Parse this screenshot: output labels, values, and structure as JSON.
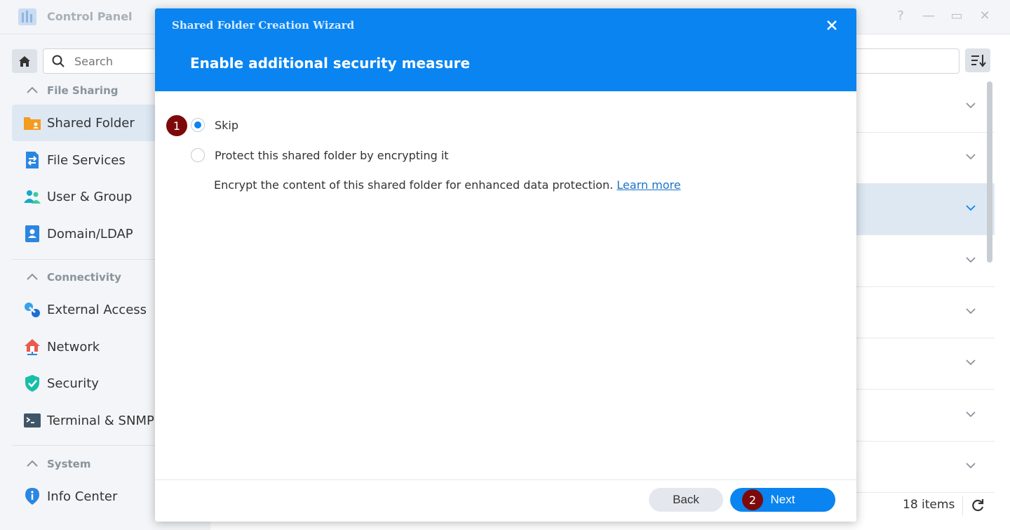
{
  "window": {
    "title": "Control Panel",
    "controls": [
      "?",
      "—",
      "▭",
      "✕"
    ]
  },
  "sidebar": {
    "search_placeholder": "Search",
    "sections": [
      {
        "label": "File Sharing",
        "items": [
          {
            "label": "Shared Folder",
            "icon": "shared-folder-icon",
            "active": true
          },
          {
            "label": "File Services",
            "icon": "file-services-icon"
          },
          {
            "label": "User & Group",
            "icon": "user-group-icon"
          },
          {
            "label": "Domain/LDAP",
            "icon": "domain-ldap-icon"
          }
        ]
      },
      {
        "label": "Connectivity",
        "items": [
          {
            "label": "External Access",
            "icon": "external-access-icon"
          },
          {
            "label": "Network",
            "icon": "network-icon"
          },
          {
            "label": "Security",
            "icon": "security-shield-icon"
          },
          {
            "label": "Terminal & SNMP",
            "icon": "terminal-icon"
          }
        ]
      },
      {
        "label": "System",
        "items": [
          {
            "label": "Info Center",
            "icon": "info-center-icon"
          }
        ]
      }
    ]
  },
  "list": {
    "item_count": "18 items"
  },
  "wizard": {
    "title": "Shared Folder Creation Wizard",
    "heading": "Enable additional security measure",
    "options": {
      "skip": "Skip",
      "encrypt": "Protect this shared folder by encrypting it"
    },
    "selected_option": "skip",
    "description": "Encrypt the content of this shared folder for enhanced data protection.",
    "learn_more": "Learn more",
    "back_label": "Back",
    "next_label": "Next",
    "step_badges": [
      "1",
      "2"
    ]
  },
  "colors": {
    "accent": "#0a84f0",
    "badge": "#7d0a0a",
    "sidebar_bg": "#f3f5f8",
    "selected_bg": "#dde8f3"
  }
}
